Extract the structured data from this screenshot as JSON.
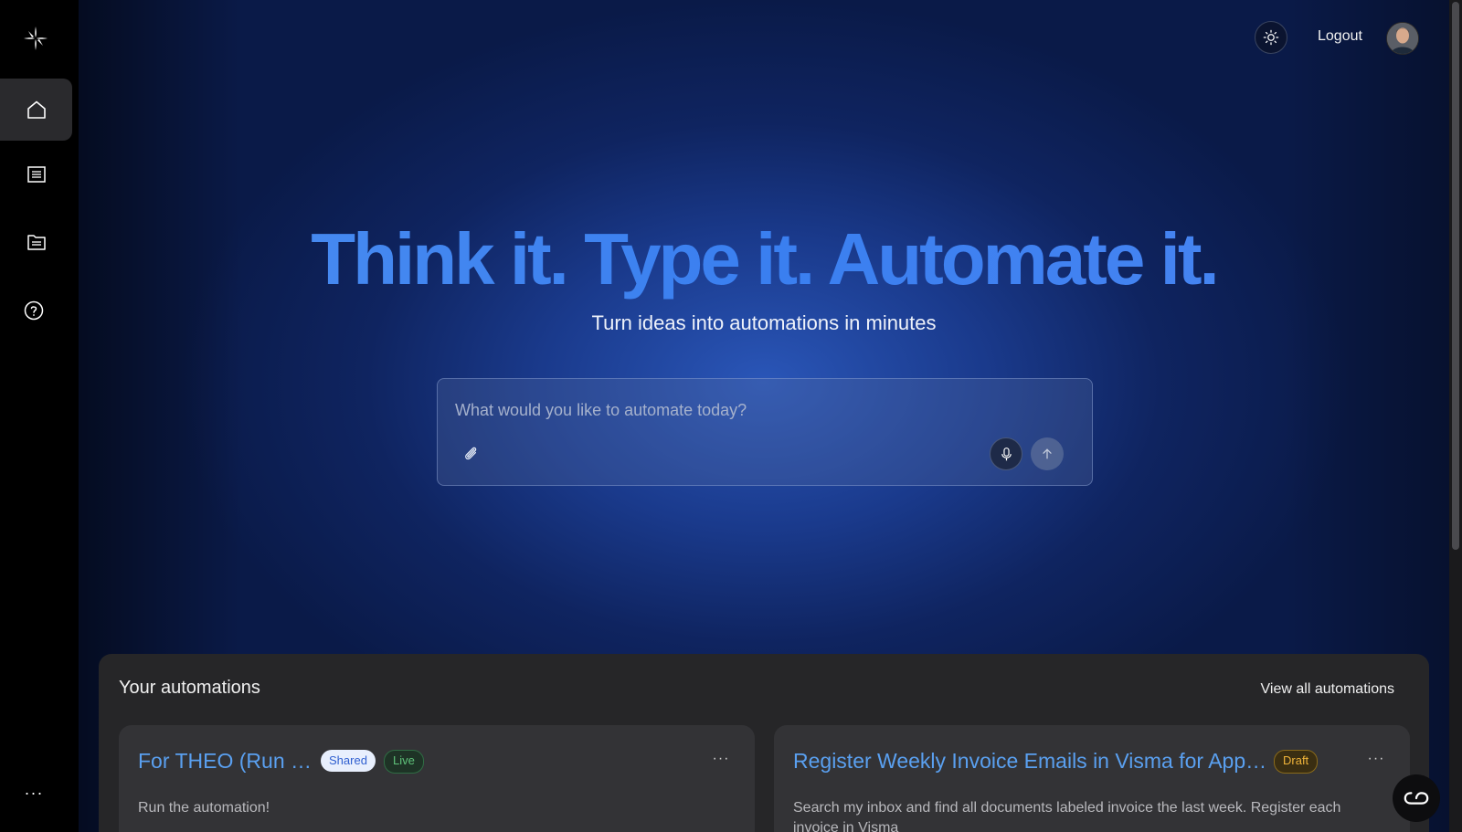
{
  "header": {
    "logout_label": "Logout"
  },
  "hero": {
    "title": "Think it. Type it. Automate it.",
    "subtitle": "Turn ideas into automations in minutes"
  },
  "prompt": {
    "placeholder": "What would you like to automate today?",
    "value": ""
  },
  "automations": {
    "title": "Your automations",
    "view_all_label": "View all automations",
    "cards": [
      {
        "title": "For THEO (Run ME)",
        "badges": [
          "Shared",
          "Live"
        ],
        "description": "Run the automation!",
        "menu": "···"
      },
      {
        "title": "Register Weekly Invoice Emails in Visma for Approval",
        "badges": [
          "Draft"
        ],
        "description": "Search my inbox and find all documents labeled invoice the last week. Register each invoice in Visma",
        "menu": "···"
      }
    ]
  },
  "sidebar": {
    "items": [
      "home-icon",
      "list-icon",
      "folder-icon",
      "help-icon"
    ],
    "more_label": "···"
  },
  "colors": {
    "accent": "#3a7ff0",
    "live": "#5fc27a",
    "draft": "#f0b43a",
    "shared_bg": "#e8effd"
  }
}
